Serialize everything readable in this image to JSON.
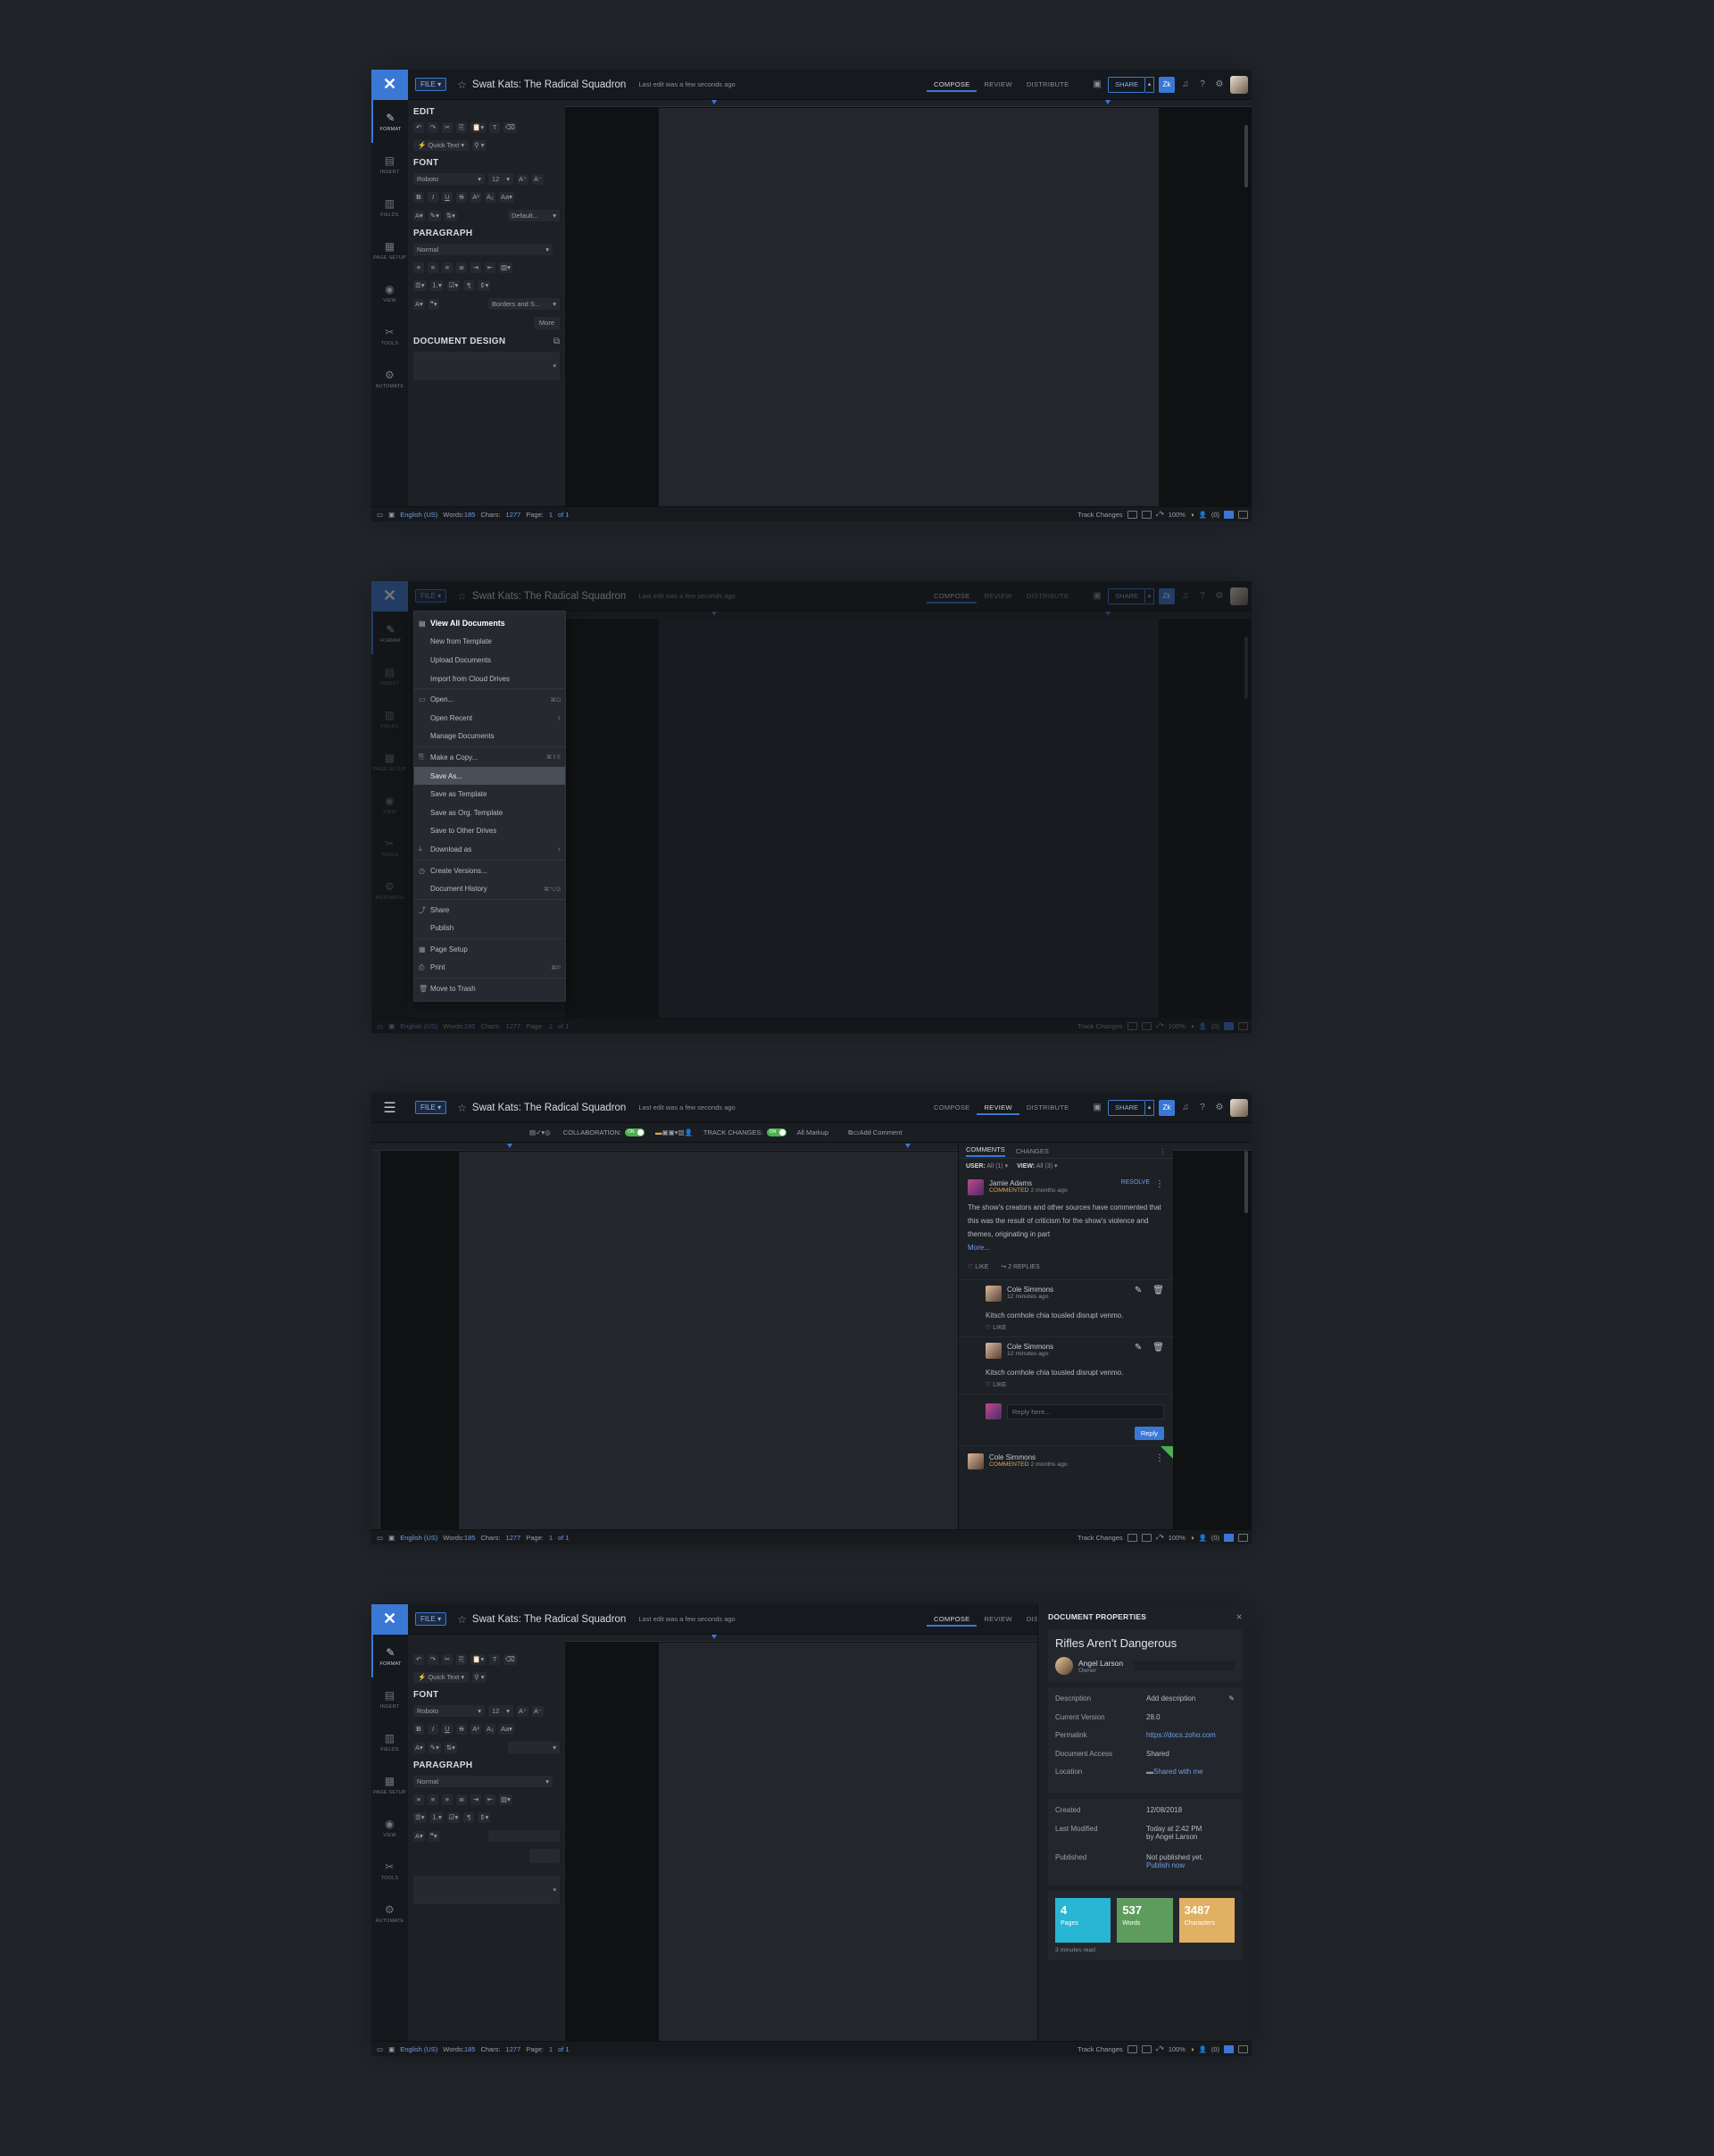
{
  "doc": {
    "file_label": "FILE",
    "title": "Swat Kats: The Radical Squadron",
    "last_edit": "Last edit was a few seconds ago"
  },
  "modes": [
    "COMPOSE",
    "REVIEW",
    "DISTRIBUTE"
  ],
  "share_label": "SHARE",
  "rail": [
    "FORMAT",
    "INSERT",
    "FIELDS",
    "PAGE SETUP",
    "VIEW",
    "TOOLS",
    "AUTOMATE"
  ],
  "format_panel": {
    "edit_title": "EDIT",
    "quick_text": "Quick Text",
    "font_title": "FONT",
    "font_name": "Roboto",
    "font_size": "12",
    "default_label": "Default...",
    "paragraph_title": "PARAGRAPH",
    "paragraph_style": "Normal",
    "borders_label": "Borders and S...",
    "more_label": "More",
    "design_title": "DOCUMENT DESIGN"
  },
  "status": {
    "language": "English (US)",
    "words_label": "Words:",
    "words": "185",
    "chars_label": "Chars:",
    "chars": "1277",
    "page_label": "Page:",
    "page_value": "1",
    "page_of": "of 1",
    "track_changes": "Track Changes",
    "zoom": "100%",
    "users": "(0)"
  },
  "file_menu": [
    {
      "label": "View All Documents",
      "icon": "documents-icon",
      "head": true
    },
    {
      "label": "New from Template"
    },
    {
      "label": "Upload Documents"
    },
    {
      "label": "Import from Cloud Drives",
      "sep_after": true
    },
    {
      "label": "Open...",
      "icon": "folder-icon",
      "shortcut": "⌘O"
    },
    {
      "label": "Open Recent",
      "submenu": true
    },
    {
      "label": "Manage Documents",
      "sep_after": true
    },
    {
      "label": "Make a Copy...",
      "icon": "copy-icon",
      "shortcut": "⌘⇧S"
    },
    {
      "label": "Save As...",
      "highlight": true
    },
    {
      "label": "Save as Template"
    },
    {
      "label": "Save as Org. Template"
    },
    {
      "label": "Save to Other Drives"
    },
    {
      "label": "Download as",
      "icon": "download-icon",
      "submenu": true,
      "sep_after": true
    },
    {
      "label": "Create Versions...",
      "icon": "versions-icon"
    },
    {
      "label": "Document History",
      "shortcut": "⌘⌥G",
      "sep_after": true
    },
    {
      "label": "Share",
      "icon": "share-icon"
    },
    {
      "label": "Publish",
      "sep_after": true
    },
    {
      "label": "Page Setup",
      "icon": "page-setup-icon"
    },
    {
      "label": "Print",
      "icon": "print-icon",
      "shortcut": "⌘P",
      "sep_after": true
    },
    {
      "label": "Move to Trash",
      "icon": "trash-icon"
    }
  ],
  "review": {
    "collaboration_label": "COLLABORATION:",
    "track_changes_label": "TRACK CHANGES:",
    "toggle_on": "ON",
    "markup": "All Markup",
    "add_comment": "Add Comment",
    "tabs": [
      "COMMENTS",
      "CHANGES"
    ],
    "user_filter_label": "USER:",
    "user_filter_value": "All (1)",
    "view_filter_label": "VIEW:",
    "view_filter_value": "All (3)",
    "comment": {
      "author": "Jamie Adams",
      "action": "COMMENTED",
      "time": "2 months ago",
      "resolve": "RESOLVE",
      "text": "The show's creators and other sources have commented that this was the result of criticism for the show's violence and themes, originating in part",
      "more": "More...",
      "like": "LIKE",
      "replies": "2 REPLIES"
    },
    "replies": [
      {
        "author": "Cole Simmons",
        "time": "12 minutes ago",
        "text": "Kitsch cornhole chia tousled disrupt venmo.",
        "like": "LIKE"
      },
      {
        "author": "Cole Simmons",
        "time": "12 minutes ago",
        "text": "Kitsch cornhole chia tousled disrupt venmo.",
        "like": "LIKE"
      }
    ],
    "reply_placeholder": "Reply here...",
    "reply_button": "Reply",
    "next_comment": {
      "author": "Cole Simmons",
      "action": "COMMENTED",
      "time": "2 months ago"
    }
  },
  "properties": {
    "title": "DOCUMENT PROPERTIES",
    "doc_name": "Rifles Aren't Dangerous",
    "owner_name": "Angel Larson",
    "owner_role": "Owner",
    "rows1": [
      {
        "k": "Description",
        "v": "Add description"
      },
      {
        "k": "Current Version",
        "v": "28.0"
      },
      {
        "k": "Permalink",
        "v": "https://docs.zoho.com"
      },
      {
        "k": "Document Access",
        "v": "Shared"
      },
      {
        "k": "Location",
        "v": "Shared with me"
      }
    ],
    "created_label": "Created",
    "created_value": "12/08/2018",
    "modified_label": "Last Modified",
    "modified_value": "Today at 2:42 PM",
    "modified_by": "by Angel Larson",
    "published_label": "Published",
    "published_value": "Not published yet.",
    "publish_now": "Publish now",
    "stats": [
      {
        "n": "4",
        "l": "Pages",
        "color": "#29b6d4"
      },
      {
        "n": "537",
        "l": "Words",
        "color": "#5e9c5e"
      },
      {
        "n": "3487",
        "l": "Characters",
        "color": "#e0b063"
      }
    ],
    "read_time": "3 minutes read"
  },
  "colors": {
    "accent": "#3a78d6",
    "background": "#21252b"
  }
}
